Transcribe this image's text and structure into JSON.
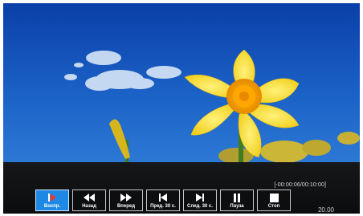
{
  "player": {
    "time_range": "[-00:00:06/00:10:00]",
    "clock": "20.00"
  },
  "controls": [
    {
      "id": "play",
      "label": "Воспр.",
      "icon": "play-icon",
      "active": true
    },
    {
      "id": "rewind",
      "label": "Назад",
      "icon": "rewind-icon",
      "active": false
    },
    {
      "id": "forward",
      "label": "Вперед",
      "icon": "fast-forward-icon",
      "active": false
    },
    {
      "id": "prev30",
      "label": "Пред. 30 с.",
      "icon": "skip-back-icon",
      "active": false
    },
    {
      "id": "next30",
      "label": "След. 30 с.",
      "icon": "skip-forward-icon",
      "active": false
    },
    {
      "id": "pause",
      "label": "Пауза",
      "icon": "pause-icon",
      "active": false
    },
    {
      "id": "stop",
      "label": "Стоп",
      "icon": "stop-icon",
      "active": false
    }
  ],
  "colors": {
    "active_button": "#1e88e5",
    "play_icon": "#e53935"
  }
}
